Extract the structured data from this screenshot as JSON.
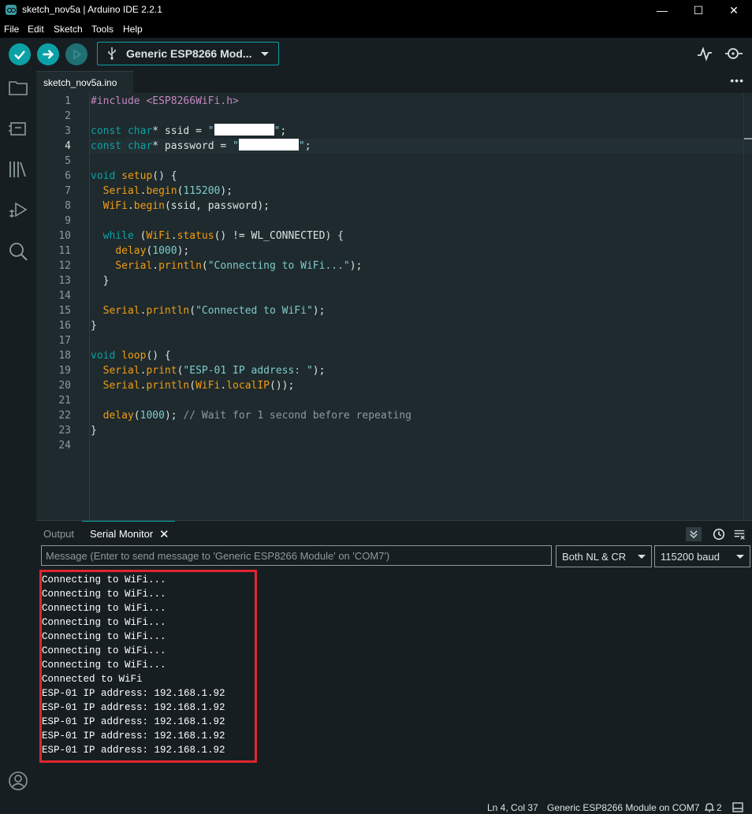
{
  "window": {
    "title": "sketch_nov5a | Arduino IDE 2.2.1",
    "minimize": "—",
    "maximize": "☐",
    "close": "✕"
  },
  "menu": [
    "File",
    "Edit",
    "Sketch",
    "Tools",
    "Help"
  ],
  "toolbar": {
    "board_label": "Generic ESP8266 Mod...",
    "icons": [
      "verify-icon",
      "upload-icon",
      "debug-icon",
      "usb-icon",
      "serial-plotter-icon",
      "serial-monitor-icon"
    ]
  },
  "sidebar": {
    "icons": [
      "folder-icon",
      "boards-manager-icon",
      "library-icon",
      "debug-icon",
      "search-icon",
      "account-icon"
    ]
  },
  "editor": {
    "tab_name": "sketch_nov5a.ino",
    "tab_more": "•••",
    "active_line": 4,
    "line_numbers": [
      "1",
      "2",
      "3",
      "4",
      "5",
      "6",
      "7",
      "8",
      "9",
      "10",
      "11",
      "12",
      "13",
      "14",
      "15",
      "16",
      "17",
      "18",
      "19",
      "20",
      "21",
      "22",
      "23",
      "24"
    ],
    "code": {
      "l1_inc": "#include",
      "l1_hdr": " <ESP8266WiFi.h>",
      "l3_a": "const",
      "l3_b": "char",
      "l3_c": "* ssid = ",
      "l3_q1": "\"",
      "l3_q2": "\"",
      "l3_end": ";",
      "l4_a": "const",
      "l4_b": "char",
      "l4_c": "* password = ",
      "l4_q1": "\"",
      "l4_q2": "\"",
      "l4_end": ";",
      "l6_a": "void",
      "l6_b": "setup",
      "l6_c": "() {",
      "l7_a": "  ",
      "l7_b": "Serial",
      "l7_c": ".",
      "l7_d": "begin",
      "l7_e": "(",
      "l7_f": "115200",
      "l7_g": ");",
      "l8_a": "  ",
      "l8_b": "WiFi",
      "l8_c": ".",
      "l8_d": "begin",
      "l8_e": "(ssid, password);",
      "l10_a": "  ",
      "l10_b": "while",
      "l10_c": " (",
      "l10_d": "WiFi",
      "l10_e": ".",
      "l10_f": "status",
      "l10_g": "() != WL_CONNECTED) {",
      "l11_a": "    ",
      "l11_b": "delay",
      "l11_c": "(",
      "l11_d": "1000",
      "l11_e": ");",
      "l12_a": "    ",
      "l12_b": "Serial",
      "l12_c": ".",
      "l12_d": "println",
      "l12_e": "(",
      "l12_f": "\"Connecting to WiFi...\"",
      "l12_g": ");",
      "l13": "  }",
      "l15_a": "  ",
      "l15_b": "Serial",
      "l15_c": ".",
      "l15_d": "println",
      "l15_e": "(",
      "l15_f": "\"Connected to WiFi\"",
      "l15_g": ");",
      "l16": "}",
      "l18_a": "void",
      "l18_b": "loop",
      "l18_c": "() {",
      "l19_a": "  ",
      "l19_b": "Serial",
      "l19_c": ".",
      "l19_d": "print",
      "l19_e": "(",
      "l19_f": "\"ESP-01 IP address: \"",
      "l19_g": ");",
      "l20_a": "  ",
      "l20_b": "Serial",
      "l20_c": ".",
      "l20_d": "println",
      "l20_e": "(",
      "l20_f": "WiFi",
      "l20_g": ".",
      "l20_h": "localIP",
      "l20_i": "());",
      "l22_a": "  ",
      "l22_b": "delay",
      "l22_c": "(",
      "l22_d": "1000",
      "l22_e": "); ",
      "l22_f": "// Wait for 1 second before repeating",
      "l23": "}"
    }
  },
  "panel": {
    "tab_output": "Output",
    "tab_serial": "Serial Monitor",
    "close": "✕",
    "message_placeholder": "Message (Enter to send message to 'Generic ESP8266 Module' on 'COM7')",
    "line_ending": "Both NL & CR",
    "baud": "115200 baud",
    "output_lines": [
      "Connecting to WiFi...",
      "Connecting to WiFi...",
      "Connecting to WiFi...",
      "Connecting to WiFi...",
      "Connecting to WiFi...",
      "Connecting to WiFi...",
      "Connecting to WiFi...",
      "Connected to WiFi",
      "ESP-01 IP address: 192.168.1.92",
      "ESP-01 IP address: 192.168.1.92",
      "ESP-01 IP address: 192.168.1.92",
      "ESP-01 IP address: 192.168.1.92",
      "ESP-01 IP address: 192.168.1.92"
    ]
  },
  "status": {
    "position": "Ln 4, Col 37",
    "board": "Generic ESP8266 Module on COM7",
    "notifications": "2"
  },
  "colors": {
    "accent": "#0ca1a6",
    "highlight_box": "#e0262e"
  }
}
